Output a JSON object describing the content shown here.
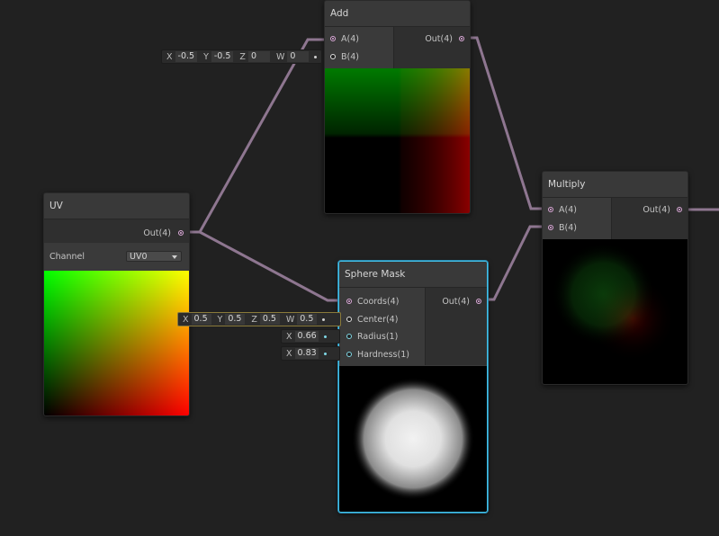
{
  "nodes": {
    "add": {
      "title": "Add",
      "inputs": [
        "A(4)",
        "B(4)"
      ],
      "output": "Out(4)",
      "b_fields": [
        {
          "label": "X",
          "value": "-0.5"
        },
        {
          "label": "Y",
          "value": "-0.5"
        },
        {
          "label": "Z",
          "value": "0"
        },
        {
          "label": "W",
          "value": "0"
        }
      ]
    },
    "uv": {
      "title": "UV",
      "output": "Out(4)",
      "channel_label": "Channel",
      "channel_value": "UV0"
    },
    "sphere_mask": {
      "title": "Sphere Mask",
      "inputs": [
        "Coords(4)",
        "Center(4)",
        "Radius(1)",
        "Hardness(1)"
      ],
      "output": "Out(4)",
      "center_fields": [
        {
          "label": "X",
          "value": "0.5"
        },
        {
          "label": "Y",
          "value": "0.5"
        },
        {
          "label": "Z",
          "value": "0.5"
        },
        {
          "label": "W",
          "value": "0.5"
        }
      ],
      "radius_field": {
        "label": "X",
        "value": "0.66"
      },
      "hardness_field": {
        "label": "X",
        "value": "0.83"
      }
    },
    "multiply": {
      "title": "Multiply",
      "inputs": [
        "A(4)",
        "B(4)"
      ],
      "output": "Out(4)"
    }
  },
  "colors": {
    "canvas": "#212121",
    "node_body": "#393939",
    "wire": "#8e7690",
    "selection": "#44c0e8",
    "port_vector": "#e7b3e4",
    "port_float": "#7fd8e6"
  }
}
